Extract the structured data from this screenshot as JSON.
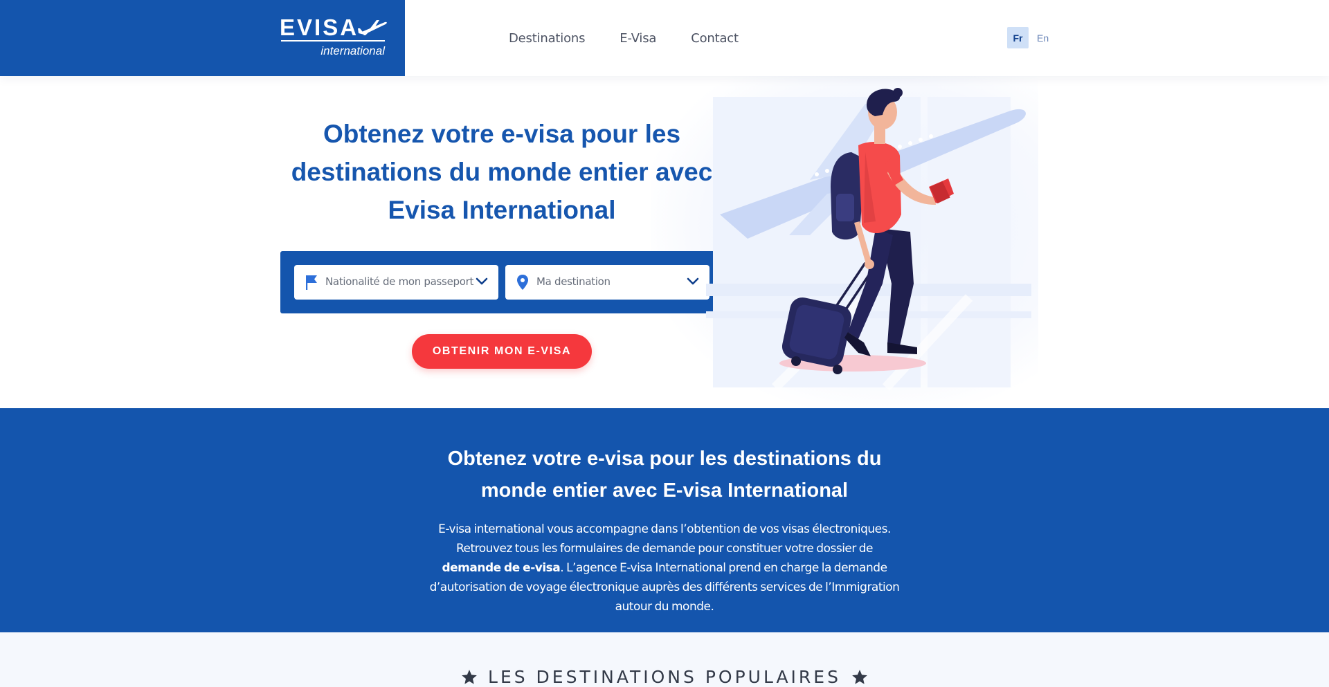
{
  "header": {
    "logo": {
      "word": "EVISA",
      "sub": "international"
    },
    "nav": [
      "Destinations",
      "E-Visa",
      "Contact"
    ],
    "languages": {
      "active": "Fr",
      "other": "En"
    }
  },
  "hero": {
    "title_strong": "Obtenez votre e-visa pour les destinations du monde entier",
    "title_rest": "avec Evisa International",
    "nationality_placeholder": "Nationalité de mon passeport",
    "destination_placeholder": "Ma destination",
    "cta_label": "OBTENIR MON E-VISA",
    "icons": {
      "nationality": "flag-icon",
      "destination": "map-pin-icon",
      "chevron": "chevron-down-icon"
    }
  },
  "intro": {
    "title": "Obtenez votre e-visa pour les destinations du monde entier avec E-visa International",
    "text_1": "E-visa international vous accompagne dans l’obtention de vos visas électroniques. Retrouvez tous les formulaires de demande pour constituer votre dossier de",
    "text_bold": "demande de e-visa",
    "text_2": ". L’agence E-visa International prend en charge la demande d’autorisation de voyage électronique auprès des différents services de l’Immigration autour du monde."
  },
  "popular": {
    "heading": "LES DESTINATIONS POPULAIRES",
    "icon": "star-icon"
  },
  "colors": {
    "brand_blue": "#1455ad",
    "cta_red": "#f5383d",
    "title_blue": "#1656ae"
  }
}
